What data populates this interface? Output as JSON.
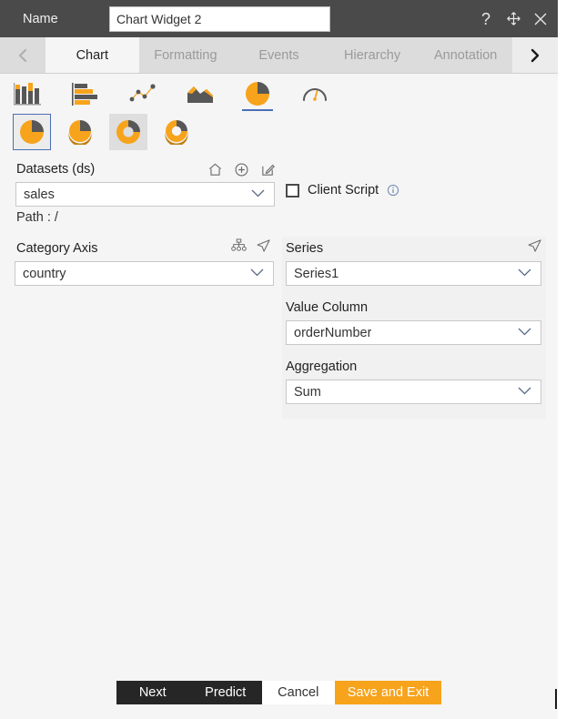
{
  "titlebar": {
    "name_label": "Name",
    "name_value": "Chart Widget 2",
    "name_placeholder": "Name",
    "help_icon": "question-mark-icon",
    "move_icon": "move-arrows-icon",
    "close_icon": "close-x-icon"
  },
  "tabs": {
    "prev_label": "‹",
    "next_label": "›",
    "items": [
      {
        "label": "Chart",
        "active": true
      },
      {
        "label": "Formatting",
        "active": false
      },
      {
        "label": "Events",
        "active": false
      },
      {
        "label": "Hierarchy",
        "active": false
      },
      {
        "label": "Annotation",
        "active": false
      }
    ]
  },
  "chart_types": {
    "primary": [
      {
        "name": "column-chart-icon",
        "selected": false
      },
      {
        "name": "bar-chart-icon",
        "selected": false
      },
      {
        "name": "line-scatter-chart-icon",
        "selected": false
      },
      {
        "name": "area-chart-icon",
        "selected": false
      },
      {
        "name": "pie-chart-icon",
        "selected": true
      },
      {
        "name": "gauge-chart-icon",
        "selected": false
      }
    ],
    "subtypes": [
      {
        "name": "pie-flat-icon",
        "state": "selected"
      },
      {
        "name": "pie-3d-icon",
        "state": "normal"
      },
      {
        "name": "donut-flat-icon",
        "state": "hover"
      },
      {
        "name": "donut-3d-icon",
        "state": "normal"
      }
    ]
  },
  "datasets": {
    "label": "Datasets (ds)",
    "value": "sales",
    "path_label": "Path :",
    "path_value": "/",
    "actions": [
      {
        "name": "home-icon"
      },
      {
        "name": "add-circle-icon"
      },
      {
        "name": "edit-pencil-icon"
      }
    ],
    "client_script": {
      "label": "Client Script",
      "checked": false,
      "info_icon": "info-circle-icon"
    }
  },
  "category_axis": {
    "title": "Category Axis",
    "value": "country",
    "icons": [
      {
        "name": "hierarchy-icon"
      },
      {
        "name": "send-cursor-icon"
      }
    ]
  },
  "series": {
    "title": "Series",
    "value": "Series1",
    "icons": [
      {
        "name": "send-cursor-icon"
      }
    ],
    "value_column_label": "Value Column",
    "value_column": "orderNumber",
    "aggregation_label": "Aggregation",
    "aggregation": "Sum"
  },
  "footer": {
    "next": "Next",
    "predict": "Predict",
    "cancel": "Cancel",
    "save_exit": "Save and Exit"
  },
  "colors": {
    "accent_orange": "#f7a31b",
    "icon_gray": "#575757",
    "titlebar": "#4a4a4a",
    "tabbar": "#dcdcdc",
    "panel_bg": "#f1f1f1",
    "select_blue": "#4a6fb5"
  }
}
